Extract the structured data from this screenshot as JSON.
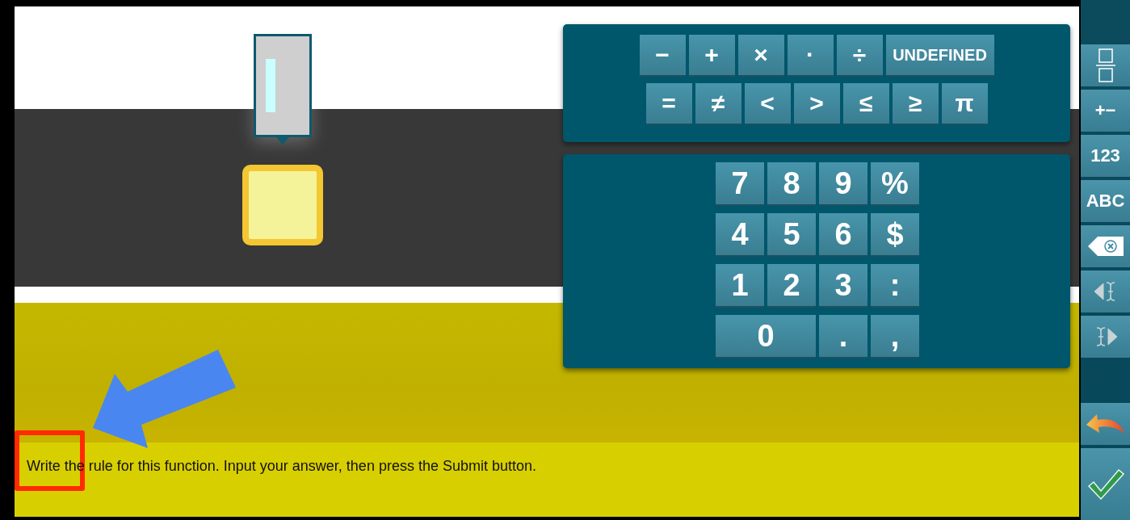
{
  "symbol_keys": [
    [
      "−",
      "+",
      "×",
      "·",
      "÷",
      "UNDEFINED"
    ],
    [
      "=",
      "≠",
      "<",
      ">",
      "≤",
      "≥",
      "π"
    ]
  ],
  "number_keys": [
    [
      {
        "label": "7",
        "wide": false
      },
      {
        "label": "8",
        "wide": false
      },
      {
        "label": "9",
        "wide": false
      },
      {
        "label": "%",
        "wide": false
      }
    ],
    [
      {
        "label": "4",
        "wide": false
      },
      {
        "label": "5",
        "wide": false
      },
      {
        "label": "6",
        "wide": false
      },
      {
        "label": "$",
        "wide": false
      }
    ],
    [
      {
        "label": "1",
        "wide": false
      },
      {
        "label": "2",
        "wide": false
      },
      {
        "label": "3",
        "wide": false
      },
      {
        "label": ":",
        "wide": false
      }
    ],
    [
      {
        "label": "0",
        "wide": true
      },
      {
        "label": ".",
        "wide": false
      },
      {
        "label": ",",
        "wide": false
      }
    ]
  ],
  "side_toolbar": [
    {
      "kind": "fraction"
    },
    {
      "kind": "text",
      "label": "+−"
    },
    {
      "kind": "text",
      "label": "123"
    },
    {
      "kind": "text",
      "label": "ABC"
    },
    {
      "kind": "backspace"
    },
    {
      "kind": "cursor-left"
    },
    {
      "kind": "cursor-right"
    },
    {
      "kind": "gap"
    },
    {
      "kind": "undo"
    },
    {
      "kind": "submit"
    }
  ],
  "instruction": "Write the rule for this function. Input your answer, then press the Submit button."
}
